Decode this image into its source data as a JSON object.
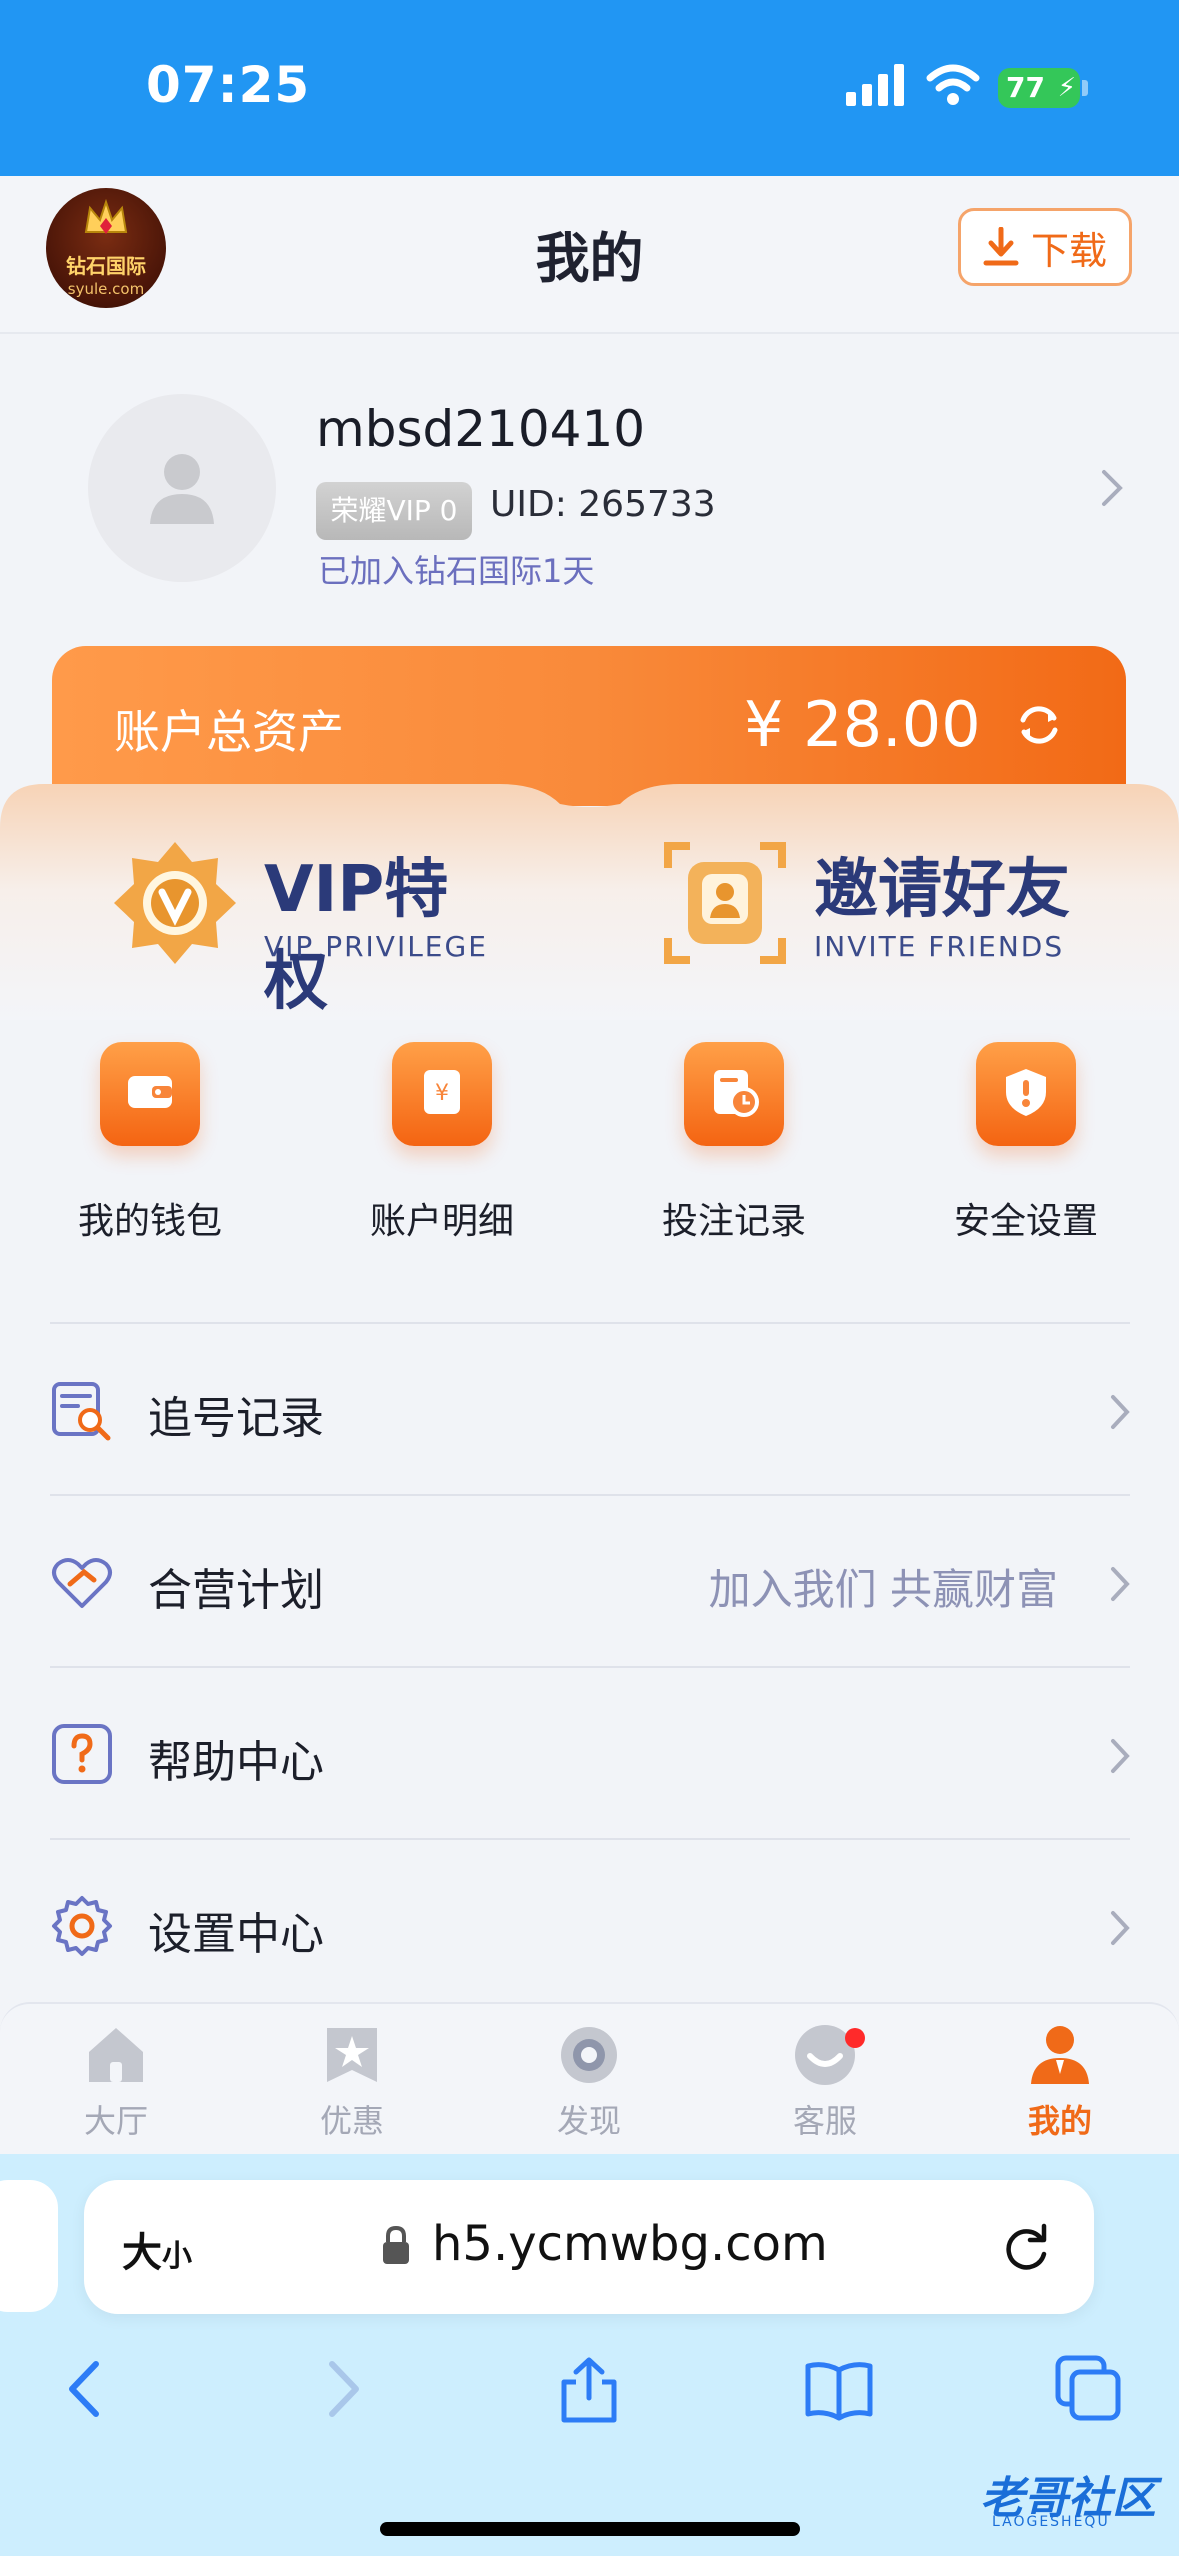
{
  "status_bar": {
    "time": "07:25",
    "battery": "77"
  },
  "header": {
    "title": "我的",
    "download_label": "下载",
    "logo_text": "钻石国际",
    "logo_sub": "syule.com"
  },
  "profile": {
    "username": "mbsd210410",
    "vip_badge": "荣耀VIP 0",
    "uid": "UID: 265733",
    "joined": "已加入钻石国际1天"
  },
  "assets": {
    "label": "账户总资产",
    "value": "¥ 28.00"
  },
  "entries": {
    "vip": {
      "title": "VIP特权",
      "subtitle": "VIP PRIVILEGE"
    },
    "invite": {
      "title": "邀请好友",
      "subtitle": "INVITE FRIENDS"
    }
  },
  "quick_actions": [
    {
      "label": "我的钱包",
      "icon": "wallet-icon"
    },
    {
      "label": "账户明细",
      "icon": "bill-icon"
    },
    {
      "label": "投注记录",
      "icon": "bet-record-icon"
    },
    {
      "label": "安全设置",
      "icon": "shield-icon"
    }
  ],
  "menu": [
    {
      "label": "追号记录",
      "extra": "",
      "icon": "search-doc-icon"
    },
    {
      "label": "合营计划",
      "extra": "加入我们 共赢财富",
      "icon": "handshake-icon"
    },
    {
      "label": "帮助中心",
      "extra": "",
      "icon": "question-icon"
    },
    {
      "label": "设置中心",
      "extra": "",
      "icon": "gear-icon"
    }
  ],
  "tabbar": [
    {
      "label": "大厅",
      "icon": "home-icon"
    },
    {
      "label": "优惠",
      "icon": "star-icon"
    },
    {
      "label": "发现",
      "icon": "discover-icon"
    },
    {
      "label": "客服",
      "icon": "chat-icon"
    },
    {
      "label": "我的",
      "icon": "user-icon",
      "active": true
    }
  ],
  "browser": {
    "size_label": "大",
    "size_small": "小",
    "url": "h5.ycmwbg.com"
  },
  "watermark": {
    "text": "老哥社区",
    "sub": "LAOGESHEQU"
  },
  "colors": {
    "accent": "#f06a18",
    "statusbar": "#2196f3",
    "navy": "#2b3a79"
  }
}
